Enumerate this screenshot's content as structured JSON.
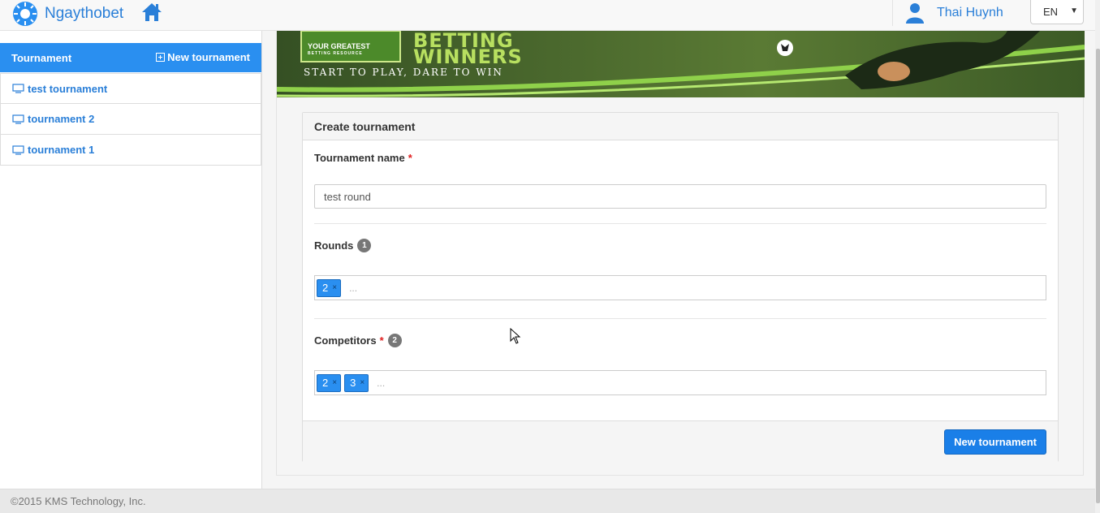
{
  "brand": {
    "name": "Ngaythobet",
    "accent": "#2a7fd8"
  },
  "nav": {
    "home_icon": "home-icon",
    "user_name": "Thai Huynh",
    "language": "EN"
  },
  "sidebar": {
    "title": "Tournament",
    "new_label": "New tournament",
    "items": [
      {
        "label": "test tournament"
      },
      {
        "label": "tournament 2"
      },
      {
        "label": "tournament 1"
      }
    ]
  },
  "banner": {
    "line1": "BETTING",
    "line2": "WINNERS",
    "tagline": "START TO PLAY, DARE TO WIN",
    "badge_line1": "YOUR GREATEST",
    "badge_line2": "BETTING RESOURCE"
  },
  "form": {
    "title": "Create tournament",
    "name_label": "Tournament name",
    "required_mark": "*",
    "name_value": "test round",
    "rounds_label": "Rounds",
    "rounds_count": "1",
    "rounds_tags": [
      "2"
    ],
    "competitors_label": "Competitors",
    "competitors_count": "2",
    "competitors_tags": [
      "2",
      "3"
    ],
    "tag_remove": "×",
    "tag_placeholder": "...",
    "submit_label": "New tournament"
  },
  "footer": {
    "copyright": "©2015 KMS Technology, Inc."
  }
}
